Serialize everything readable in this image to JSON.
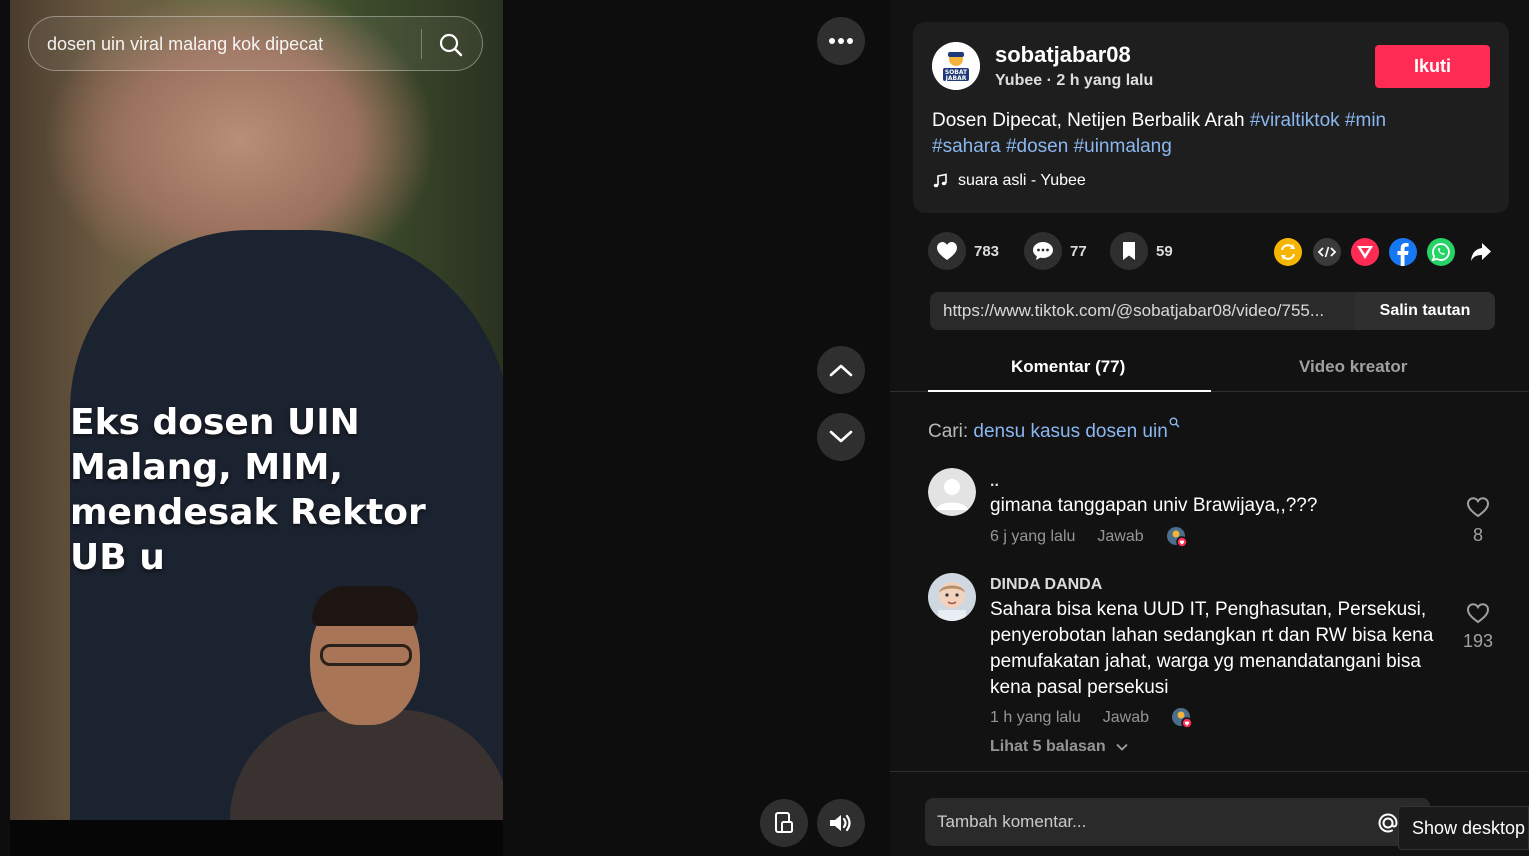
{
  "video": {
    "search_query": "dosen uin viral malang kok dipecat",
    "overlay_caption": "Eks dosen UIN\nMalang, MIM,\nmendesak Rektor\nUB u"
  },
  "post": {
    "username": "sobatjabar08",
    "author_name": "Yubee",
    "time_ago": "2 h yang lalu",
    "meta_separator": " · ",
    "avatar_text_top": "SOBAT",
    "avatar_text_bottom": "JABAR",
    "follow_label": "Ikuti",
    "description_text": "Dosen Dipecat, Netijen Berbalik Arah ",
    "hashtags": [
      "#viraltiktok",
      "#min",
      "#sahara",
      "#dosen",
      "#uinmalang"
    ],
    "music": "suara asli - Yubee"
  },
  "actions": {
    "likes": "783",
    "comments": "77",
    "bookmarks": "59"
  },
  "share_colors": {
    "repost": "#f6b500",
    "embed": "#3a3a3a",
    "send": "#fe2c55",
    "facebook": "#1877f2",
    "whatsapp": "#25d366"
  },
  "link": {
    "url": "https://www.tiktok.com/@sobatjabar08/video/755...",
    "copy_label": "Salin tautan"
  },
  "tabs": [
    {
      "label": "Komentar (77)",
      "active": true
    },
    {
      "label": "Video kreator",
      "active": false
    }
  ],
  "search_suggestion": {
    "prefix": "Cari: ",
    "query": "densu kasus dosen uin"
  },
  "comments": [
    {
      "name": "..",
      "text": "gimana tanggapan univ Brawijaya,,???",
      "time": "6 j yang lalu",
      "reply_label": "Jawab",
      "likes": "8"
    },
    {
      "name": "DINDA DANDA",
      "text": "Sahara bisa kena UUD IT, Penghasutan, Persekusi, penyerobotan lahan sedangkan rt dan RW bisa kena pemufakatan jahat, warga yg menandatangani bisa kena pasal persekusi",
      "time": "1 h yang lalu",
      "reply_label": "Jawab",
      "likes": "193",
      "view_replies": "Lihat 5 balasan"
    }
  ],
  "comment_input": {
    "placeholder": "Tambah komentar..."
  },
  "tooltip": "Show desktop"
}
